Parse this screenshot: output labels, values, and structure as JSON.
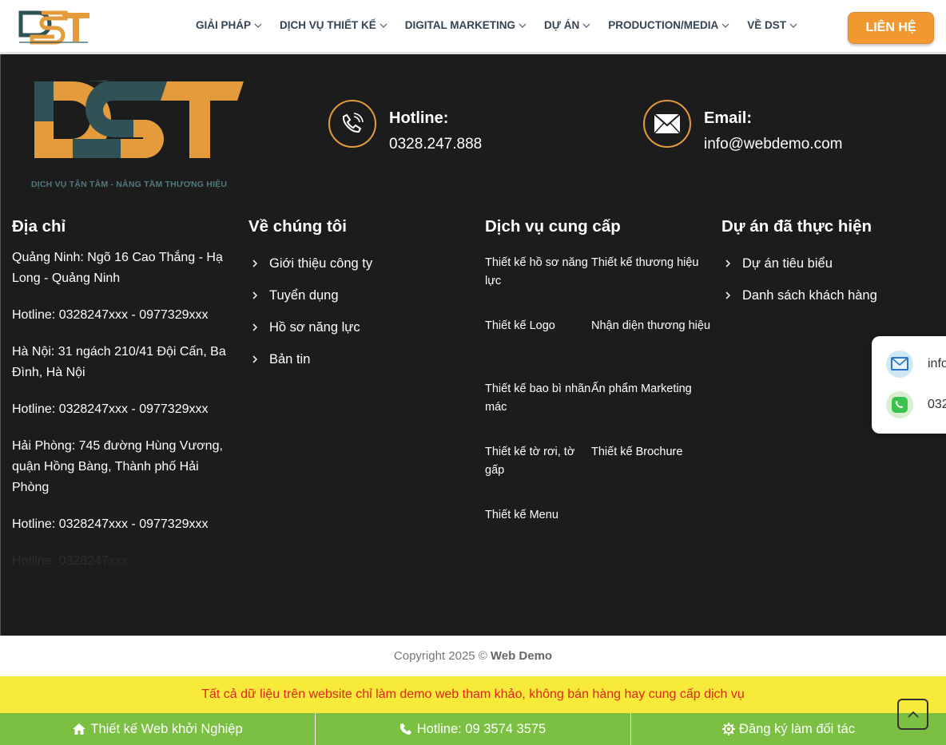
{
  "header": {
    "logo_alt": "DST",
    "nav": [
      {
        "label": "GIẢI PHÁP"
      },
      {
        "label": "DỊCH VỤ THIẾT KẾ"
      },
      {
        "label": "DIGITAL MARKETING"
      },
      {
        "label": "DỰ ÁN"
      },
      {
        "label": "PRODUCTION/MEDIA"
      },
      {
        "label": "VỀ DST"
      }
    ],
    "cta_label": "LIÊN HỆ"
  },
  "brand": {
    "tagline": "DỊCH VỤ TẬN TÂM - NÂNG TẦM THƯƠNG HIỆU",
    "colors": {
      "orange": "#e39b3c",
      "teal": "#2e5256",
      "dark": "#1d1c1d",
      "green": "#7bc043",
      "yellow": "#f7ea3a",
      "red": "#e0261b"
    }
  },
  "contacts": {
    "hotline": {
      "label": "Hotline:",
      "value": "0328.247.888",
      "icon": "phone-icon"
    },
    "email": {
      "label": "Email:",
      "value": "info@webdemo.com",
      "icon": "mail-icon"
    }
  },
  "address": {
    "title": "Địa chỉ",
    "lines": [
      "Quảng Ninh: Ngõ 16 Cao Thắng - Hạ Long - Quảng Ninh",
      "Hotline: 0328247xxx - 0977329xxx",
      "Hà Nội: 31 ngách 210/41 Đội Cấn, Ba Đình, Hà Nội",
      "Hotline: 0328247xxx - 0977329xxx",
      "Hải Phòng: 745 đường Hùng Vương, quận Hồng Bàng, Thành phố Hải Phòng",
      "Hotline: 0328247xxx - 0977329xxx"
    ],
    "faded_line": "Hotline: 0328247xxx"
  },
  "about": {
    "title": "Về chúng tôi",
    "links": [
      "Giới thiệu công ty",
      "Tuyển dụng",
      "Hồ sơ năng lực",
      "Bản tin"
    ]
  },
  "services": {
    "title": "Dịch vụ cung cấp",
    "items": [
      "Thiết kế hồ sơ năng lực",
      "Thiết kế thương hiệu",
      "Thiết kế Logo",
      "Nhận diện thương hiệu",
      "Thiết kế bao bì nhãn mác",
      "Ấn phẩm Marketing",
      "Thiết kế tờ rơi, tờ gấp",
      "Thiết kế Brochure",
      "Thiết kế Menu"
    ]
  },
  "projects": {
    "title": "Dự án đã thực hiện",
    "links": [
      "Dự án tiêu biểu",
      "Danh sách khách hàng"
    ]
  },
  "widget": {
    "email_text": "info",
    "phone_text": "032"
  },
  "copyright": {
    "prefix": "Copyright 2025 ©",
    "brand": "Web Demo"
  },
  "notice": "Tất cả dữ liệu trên website chỉ làm demo web tham khảo, không bán hàng hay cung cấp dịch vụ",
  "bottom_bar": [
    {
      "label": "Thiết kế Web khởi Nghiệp",
      "icon": "home-icon"
    },
    {
      "label": "Hotline: 09 3574 3575",
      "icon": "phone-icon"
    },
    {
      "label": "Đăng ký làm đối tác",
      "icon": "gear-icon"
    }
  ]
}
